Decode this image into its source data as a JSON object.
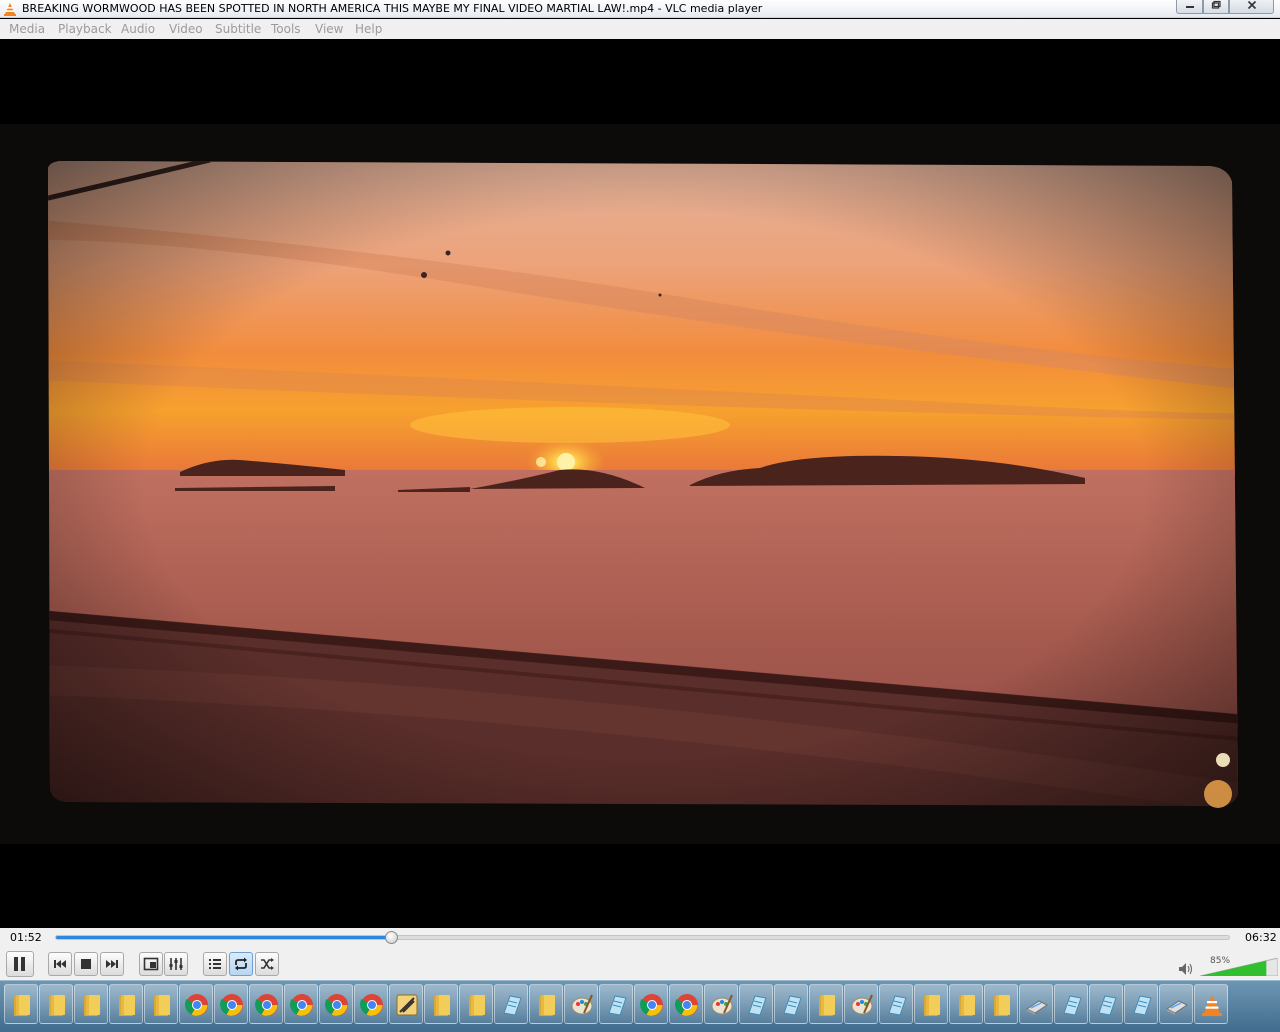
{
  "window": {
    "title": "BREAKING WORMWOOD HAS BEEN SPOTTED IN NORTH AMERICA THIS MAYBE  MY FINAL VIDEO MARTIAL LAW!.mp4 - VLC media player",
    "icon": "vlc-cone-icon",
    "controls": [
      "minimize-icon",
      "maximize-icon",
      "close-icon"
    ]
  },
  "menu": {
    "items": [
      "Media",
      "Playback",
      "Audio",
      "Video",
      "Subtitle",
      "Tools",
      "View",
      "Help"
    ]
  },
  "player": {
    "time_elapsed": "01:52",
    "time_total": "06:32",
    "progress_fraction": 0.2857,
    "volume_label": "85%",
    "volume_fraction": 0.85,
    "accent_color": "#2e86de",
    "volume_color": "#2fbf2f",
    "buttons": [
      "pause-icon",
      "previous-icon",
      "stop-icon",
      "next-icon",
      "fullscreen-icon",
      "extended-settings-icon",
      "playlist-icon",
      "loop-icon",
      "random-icon"
    ],
    "active_button": "loop-icon"
  },
  "video": {
    "description_icon": "sunset-over-sea-video-frame",
    "sky_top": "#e8b89a",
    "sky_mid": "#f08a3c",
    "sun": "#ffe36a",
    "sea": "#a4574a"
  },
  "taskbar": {
    "items": [
      "folder-icon",
      "folder-icon",
      "folder-icon",
      "folder-icon",
      "folder-icon",
      "chrome-icon",
      "chrome-icon",
      "chrome-icon",
      "chrome-icon",
      "chrome-icon",
      "chrome-icon",
      "tool-icon",
      "folder-icon",
      "folder-icon",
      "notepad-icon",
      "folder-icon",
      "paint-icon",
      "notepad-icon",
      "chrome-icon",
      "chrome-icon",
      "paint-icon",
      "notepad-icon",
      "notepad-icon",
      "folder-icon",
      "paint-icon",
      "notepad-icon",
      "folder-icon",
      "folder-icon",
      "folder-icon",
      "scanner-icon",
      "notepad-icon",
      "notepad-icon",
      "notepad-icon",
      "scanner-icon",
      "vlc-cone-icon"
    ]
  }
}
